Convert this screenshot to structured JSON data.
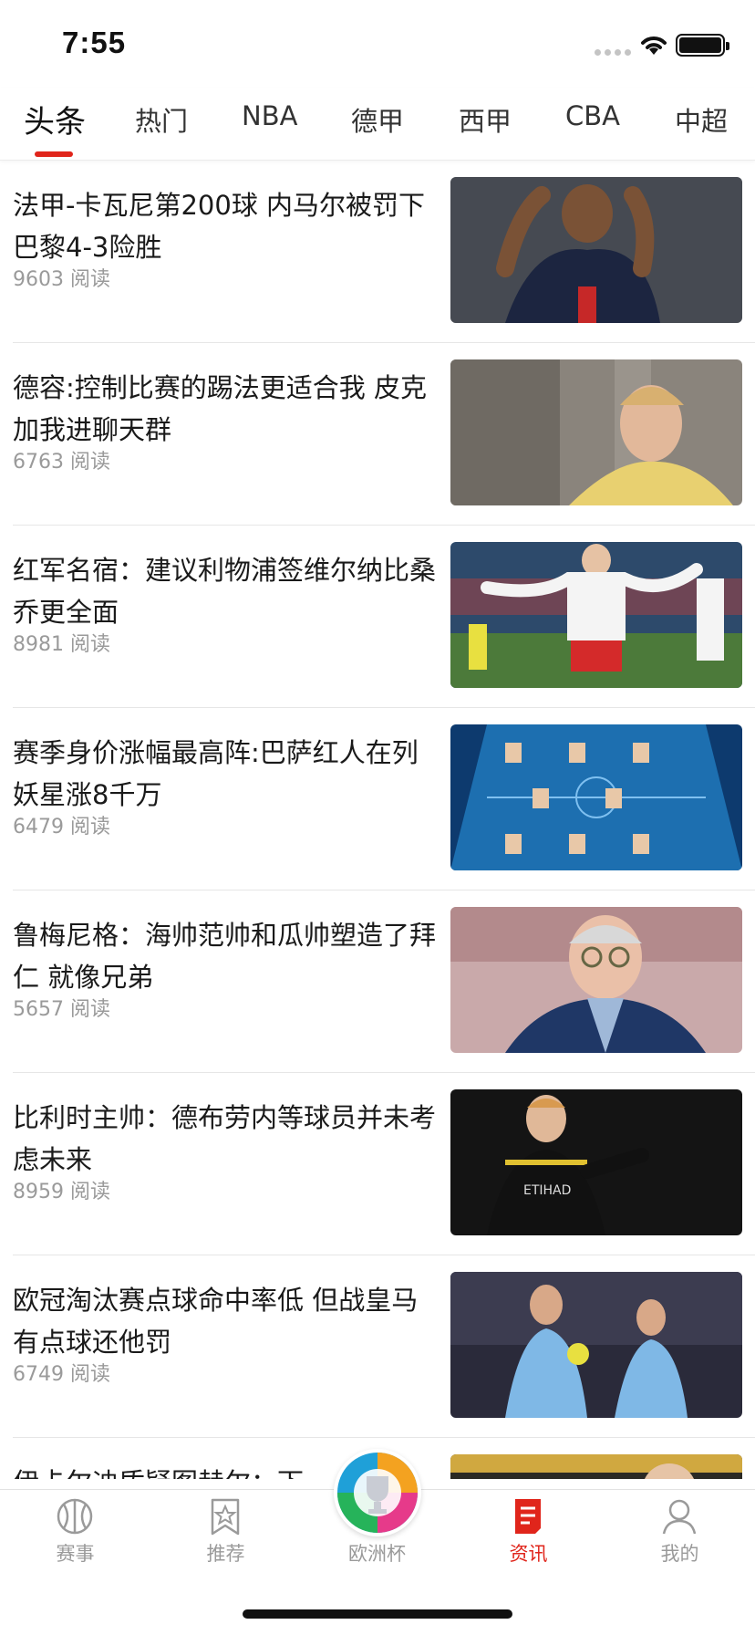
{
  "status_bar": {
    "time": "7:55"
  },
  "tabs": [
    {
      "label": "头条",
      "active": true
    },
    {
      "label": "热门",
      "active": false
    },
    {
      "label": "NBA",
      "active": false
    },
    {
      "label": "德甲",
      "active": false
    },
    {
      "label": "西甲",
      "active": false
    },
    {
      "label": "CBA",
      "active": false
    },
    {
      "label": "中超",
      "active": false
    }
  ],
  "news": [
    {
      "title": "法甲-卡瓦尼第200球 内马尔被罚下 巴黎4-3险胜",
      "reads": "9603 阅读",
      "thumb": "psg-player-celebrating"
    },
    {
      "title": "德容:控制比赛的踢法更适合我 皮克加我进聊天群",
      "reads": "6763 阅读",
      "thumb": "player-interview"
    },
    {
      "title": "红军名宿：建议利物浦签维尔纳比桑乔更全面",
      "reads": "8981 阅读",
      "thumb": "leipzig-player-celebrating"
    },
    {
      "title": "赛季身价涨幅最高阵:巴萨红人在列 妖星涨8千万",
      "reads": "6479 阅读",
      "thumb": "lineup-graphic"
    },
    {
      "title": "鲁梅尼格：海帅范帅和瓜帅塑造了拜仁 就像兄弟",
      "reads": "5657 阅读",
      "thumb": "executive-smiling"
    },
    {
      "title": "比利时主帅：德布劳内等球员并未考虑未来",
      "reads": "8959 阅读",
      "thumb": "city-player-pointing"
    },
    {
      "title": "欧冠淘汰赛点球命中率低 但战皇马有点球还他罚",
      "reads": "6749 阅读",
      "thumb": "city-players-celebrating"
    },
    {
      "title": "伊卡尔迪质疑图赫尔：下",
      "reads": "",
      "thumb": "partial-photo"
    }
  ],
  "bottom_nav": [
    {
      "label": "赛事",
      "icon": "basketball-icon",
      "active": false
    },
    {
      "label": "推荐",
      "icon": "bookmark-star-icon",
      "active": false
    },
    {
      "label": "欧洲杯",
      "icon": "euro-cup-icon",
      "active": false
    },
    {
      "label": "资讯",
      "icon": "news-doc-icon",
      "active": true
    },
    {
      "label": "我的",
      "icon": "profile-icon",
      "active": false
    }
  ],
  "colors": {
    "accent": "#e0251b",
    "text": "#1a1a1a",
    "muted": "#9a9a9a"
  }
}
